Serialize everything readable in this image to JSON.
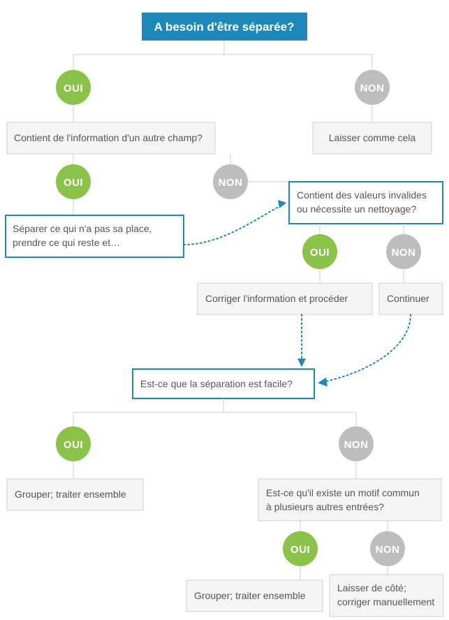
{
  "labels": {
    "yes": "OUI",
    "no": "NON"
  },
  "nodes": {
    "root": "A besoin d'être séparée?",
    "other_field_line1": "Contient de l'information d'un autre champ?",
    "leave_as_is": "Laisser comme cela",
    "separate_line1": "Séparer ce qui n'a pas sa place,",
    "separate_line2": "prendre ce qui reste et…",
    "invalid_line1": "Contient des valeurs invalides",
    "invalid_line2": "ou nécessite un nettoyage?",
    "correct_proceed": "Corriger l'information et procéder",
    "continue": "Continuer",
    "easy": "Est-ce que la séparation est facile?",
    "group1": "Grouper; traiter ensemble",
    "motif_line1": "Est-ce qu'il existe un motif commun",
    "motif_line2": "à plusieurs autres entrées?",
    "group2": "Grouper; traiter ensemble",
    "aside_line1": "Laisser de côté;",
    "aside_line2": "corriger manuellement"
  },
  "chart_data": {
    "type": "flowchart",
    "root": {
      "text": "A besoin d'être séparée?",
      "yes": {
        "text": "Contient de l'information d'un autre champ?",
        "yes": {
          "text": "Séparer ce qui n'a pas sa place, prendre ce qui reste et…",
          "next": "invalid_values_question"
        },
        "no": {
          "id": "invalid_values_question",
          "text": "Contient des valeurs invalides ou nécessite un nettoyage?",
          "yes": {
            "text": "Corriger l'information et procéder",
            "next": "easy_separation_question"
          },
          "no": {
            "text": "Continuer",
            "next": "easy_separation_question"
          }
        }
      },
      "no": {
        "text": "Laisser comme cela"
      }
    },
    "easy_separation_question": {
      "text": "Est-ce que la séparation est facile?",
      "yes": {
        "text": "Grouper; traiter ensemble"
      },
      "no": {
        "text": "Est-ce qu'il existe un motif commun à plusieurs autres entrées?",
        "yes": {
          "text": "Grouper; traiter ensemble"
        },
        "no": {
          "text": "Laisser de côté; corriger manuellement"
        }
      }
    }
  }
}
